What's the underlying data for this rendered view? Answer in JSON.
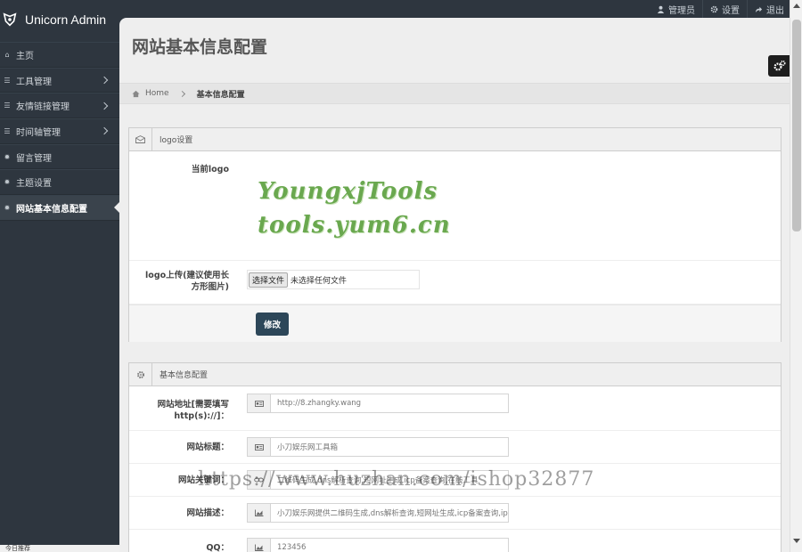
{
  "brand": {
    "name": "Unicorn Admin"
  },
  "topbar": {
    "items": [
      {
        "icon": "user-icon",
        "label": "管理员"
      },
      {
        "icon": "gear-icon",
        "label": "设置"
      },
      {
        "icon": "share-icon",
        "label": "退出"
      }
    ]
  },
  "sidebar": {
    "items": [
      {
        "icon": "home-icon",
        "label": "主页"
      },
      {
        "icon": "list-icon",
        "label": "工具管理"
      },
      {
        "icon": "list-icon",
        "label": "友情链接管理"
      },
      {
        "icon": "list-icon",
        "label": "时间轴管理"
      },
      {
        "icon": "gear-icon",
        "label": "留言管理"
      },
      {
        "icon": "gear-icon",
        "label": "主题设置"
      },
      {
        "icon": "gear-icon",
        "label": "网站基本信息配置"
      }
    ]
  },
  "page": {
    "title": "网站基本信息配置"
  },
  "breadcrumb": {
    "home": "Home",
    "current": "基本信息配置"
  },
  "logo_box": {
    "title": "logo设置",
    "current_label": "当前logo",
    "logo_line1": "YoungxjTools",
    "logo_line2": "tools.yum6.cn",
    "upload_label": "logo上传(建议使用长方形图片)",
    "file_button": "选择文件",
    "file_status": "未选择任何文件",
    "submit": "修改"
  },
  "info_box": {
    "title": "基本信息配置",
    "fields": [
      {
        "label": "网站地址[需要填写http(s)://]：",
        "icon": "id-card-icon",
        "value": "http://8.zhangky.wang"
      },
      {
        "label": "网站标题：",
        "icon": "id-card-icon",
        "value": "小刀娱乐网工具箱"
      },
      {
        "label": "网站关键词：",
        "icon": "link-icon",
        "value": "二维码生成,dns解析查询,短网址生成,icp备案查询,在线工具"
      },
      {
        "label": "网站描述：",
        "icon": "chart-icon",
        "value": "小刀娱乐网提供二维码生成,dns解析查询,短网址生成,icp备案查询,ip"
      },
      {
        "label": "QQ：",
        "icon": "chart-icon",
        "value": "123456"
      }
    ]
  },
  "watermark": "https://www.huzhan.com/ishop32877",
  "statusbar": "今日推荐"
}
